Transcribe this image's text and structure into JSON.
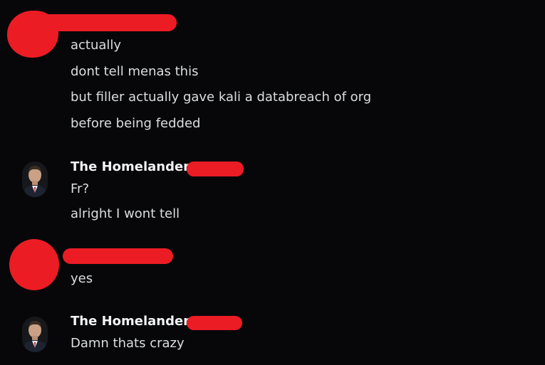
{
  "colors": {
    "background": "#070709",
    "redaction": "#ec1c24",
    "username": "#f2f3f5",
    "message_text": "#dbdee1"
  },
  "groups": [
    {
      "author": "",
      "author_redacted": true,
      "avatar": "redacted-avatar",
      "messages": [
        "actually",
        "dont tell menas this",
        "but filler actually gave kali a databreach of org",
        "before being fedded"
      ]
    },
    {
      "author": "The Homelander",
      "author_redacted": false,
      "avatar": "homelander-avatar",
      "messages": [
        "Fr?",
        "alright I wont tell"
      ]
    },
    {
      "author": "",
      "author_redacted": true,
      "avatar": "redacted-avatar",
      "messages": [
        "yes"
      ]
    },
    {
      "author": "The Homelander",
      "author_redacted": false,
      "avatar": "homelander-avatar",
      "messages": [
        "Damn thats crazy"
      ]
    }
  ]
}
